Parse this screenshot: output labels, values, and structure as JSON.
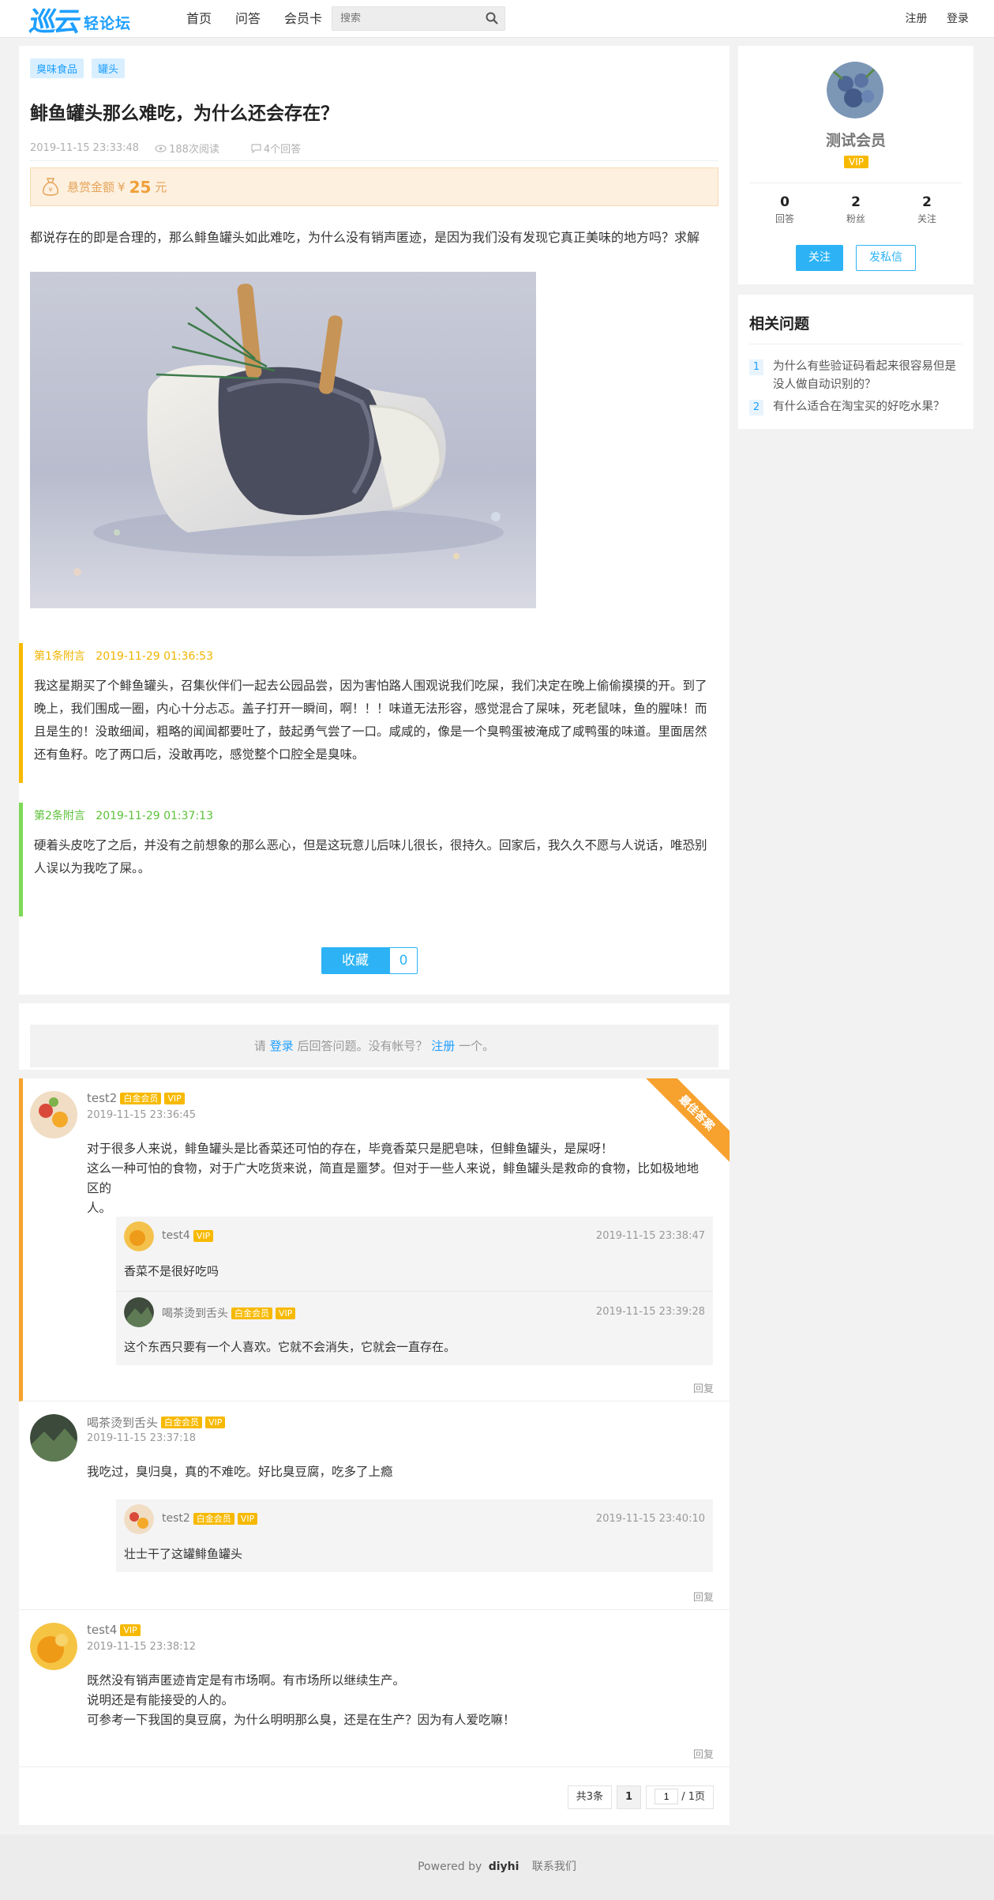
{
  "header": {
    "logo_main": "巡云",
    "logo_sub": "轻论坛",
    "nav": [
      "首页",
      "问答",
      "会员卡"
    ],
    "search_placeholder": "搜索",
    "register": "注册",
    "login": "登录"
  },
  "question": {
    "tags": [
      "臭味食品",
      "罐头"
    ],
    "title": "鲱鱼罐头那么难吃，为什么还会存在？",
    "time": "2019-11-15 23:33:48",
    "views": "188次阅读",
    "answers": "4个回答",
    "reward_label": "悬赏金额",
    "reward_currency": "¥",
    "reward_amount": "25",
    "reward_unit": "元",
    "body": "都说存在的即是合理的，那么鲱鱼罐头如此难吃，为什么没有销声匿迹，是因为我们没有发现它真正美味的地方吗？求解",
    "appends": [
      {
        "label": "第1条附言",
        "time": "2019-11-29 01:36:53",
        "text": "我这星期买了个鲱鱼罐头，召集伙伴们一起去公园品尝，因为害怕路人围观说我们吃屎，我们决定在晚上偷偷摸摸的开。到了晚上，我们围成一圈，内心十分忐忑。盖子打开一瞬间，啊！！！味道无法形容，感觉混合了屎味，死老鼠味，鱼的腥味！而且是生的！没敢细闻，粗略的闻闻都要吐了，鼓起勇气尝了一口。咸咸的，像是一个臭鸭蛋被淹成了咸鸭蛋的味道。里面居然还有鱼籽。吃了两口后，没敢再吃，感觉整个口腔全是臭味。",
        "color": "#f7b900"
      },
      {
        "label": "第2条附言",
        "time": "2019-11-29 01:37:13",
        "text": "硬着头皮吃了之后，并没有之前想象的那么恶心，但是这玩意儿后味儿很长，很持久。回家后，我久久不愿与人说话，唯恐别人误以为我吃了屎。。",
        "color": "#7ed957"
      }
    ],
    "favorite_label": "收藏",
    "favorite_count": "0"
  },
  "login_tip": {
    "pre": "请",
    "login": "登录",
    "mid": "后回答问题。没有帐号？",
    "register": "注册",
    "post": "一个。"
  },
  "best_ribbon": "最佳答案",
  "answers": [
    {
      "user": "test2",
      "badges": [
        "白金会员",
        "VIP"
      ],
      "time": "2019-11-15 23:36:45",
      "lines": [
        "对于很多人来说，鲱鱼罐头是比香菜还可怕的存在，毕竟香菜只是肥皂味，但鲱鱼罐头，是屎呀！",
        "这么一种可怕的食物，对于广大吃货来说，简直是噩梦。但对于一些人来说，鲱鱼罐头是救命的食物，比如极地地区的",
        "人。"
      ],
      "replies": [
        {
          "user": "test4",
          "badges": [
            "VIP"
          ],
          "time": "2019-11-15 23:38:47",
          "text": "香菜不是很好吃吗"
        },
        {
          "user": "喝茶烫到舌头",
          "badges": [
            "白金会员",
            "VIP"
          ],
          "time": "2019-11-15 23:39:28",
          "text": "这个东西只要有一个人喜欢。它就不会消失，它就会一直存在。"
        }
      ],
      "reply_label": "回复"
    },
    {
      "user": "喝茶烫到舌头",
      "badges": [
        "白金会员",
        "VIP"
      ],
      "time": "2019-11-15 23:37:18",
      "lines": [
        "我吃过，臭归臭，真的不难吃。好比臭豆腐，吃多了上瘾"
      ],
      "replies": [
        {
          "user": "test2",
          "badges": [
            "白金会员",
            "VIP"
          ],
          "time": "2019-11-15 23:40:10",
          "text": "壮士干了这罐鲱鱼罐头"
        }
      ],
      "reply_label": "回复"
    },
    {
      "user": "test4",
      "badges": [
        "VIP"
      ],
      "time": "2019-11-15 23:38:12",
      "lines": [
        "既然没有销声匿迹肯定是有市场啊。有市场所以继续生产。",
        "说明还是有能接受的人的。",
        "可参考一下我国的臭豆腐，为什么明明那么臭，还是在生产？因为有人爱吃嘛！"
      ],
      "replies": [],
      "reply_label": "回复"
    }
  ],
  "pager": {
    "total": "共3条",
    "current": "1",
    "input_value": "1",
    "pages": "/ 1页"
  },
  "profile": {
    "name": "测试会员",
    "badge": "VIP",
    "stats": [
      {
        "n": "0",
        "l": "回答"
      },
      {
        "n": "2",
        "l": "粉丝"
      },
      {
        "n": "2",
        "l": "关注"
      }
    ],
    "follow": "关注",
    "message": "发私信"
  },
  "related": {
    "title": "相关问题",
    "items": [
      {
        "num": "1",
        "text": "为什么有些验证码看起来很容易但是没人做自动识别的？"
      },
      {
        "num": "2",
        "text": "有什么适合在淘宝买的好吃水果？"
      }
    ]
  },
  "footer": {
    "powered": "Powered by",
    "brand": "diyhi",
    "contact": "联系我们"
  },
  "colors": {
    "accent": "#1e9fff",
    "button": "#2db3f5",
    "best": "#f7a12e",
    "vip": "#f7b900"
  }
}
